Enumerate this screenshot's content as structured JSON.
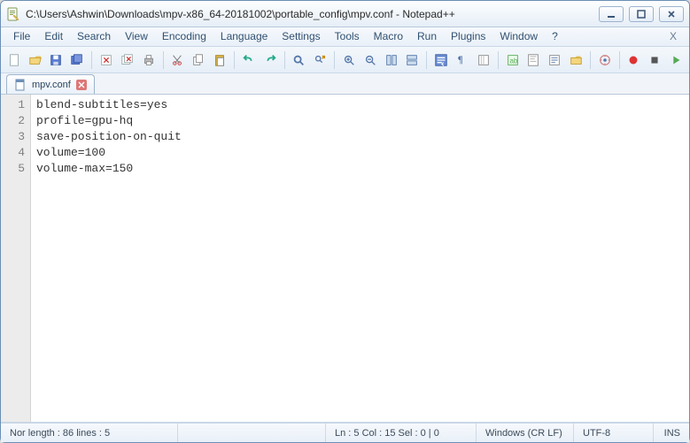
{
  "window": {
    "title": "C:\\Users\\Ashwin\\Downloads\\mpv-x86_64-20181002\\portable_config\\mpv.conf - Notepad++"
  },
  "menu": {
    "items": [
      "File",
      "Edit",
      "Search",
      "View",
      "Encoding",
      "Language",
      "Settings",
      "Tools",
      "Macro",
      "Run",
      "Plugins",
      "Window",
      "?"
    ],
    "closeX": "X"
  },
  "toolbar": {
    "buttons": [
      "new-file",
      "open-file",
      "save-file",
      "save-all",
      "sep",
      "close-file",
      "close-all",
      "print",
      "sep",
      "cut",
      "copy",
      "paste",
      "sep",
      "undo",
      "redo",
      "sep",
      "find",
      "replace",
      "sep",
      "zoom-in",
      "zoom-out",
      "sync-v",
      "sync-h",
      "sep",
      "word-wrap",
      "show-all-chars",
      "indent-guide",
      "sep",
      "user-lang",
      "doc-map",
      "func-list",
      "folder-view",
      "sep",
      "show-monitor",
      "sep",
      "record-macro",
      "stop-macro",
      "play-macro"
    ]
  },
  "tabs": [
    {
      "label": "mpv.conf",
      "dirty": false
    }
  ],
  "editor": {
    "lines": [
      "blend-subtitles=yes",
      "profile=gpu-hq",
      "save-position-on-quit",
      "volume=100",
      "volume-max=150"
    ],
    "currentLine": 5
  },
  "status": {
    "left": "Nor  length : 86      lines : 5",
    "pos": "Ln : 5    Col : 15    Sel : 0 | 0",
    "eol": "Windows (CR LF)",
    "enc": "UTF-8",
    "mode": "INS"
  },
  "colors": {
    "title_border": "#6b8fb4",
    "gutter_bg": "#ececec",
    "current_line_bg": "#e8edf6"
  }
}
